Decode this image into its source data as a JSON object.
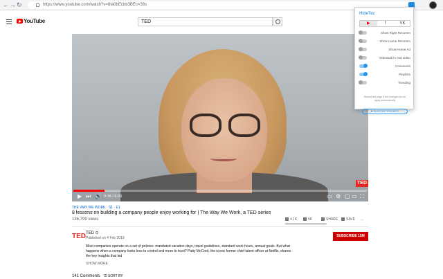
{
  "browser": {
    "url": "https://www.youtube.com/watch?v=8Ia0bEcbb3BEc=38s"
  },
  "header": {
    "logo_text": "YouTube",
    "search_value": "TED"
  },
  "player": {
    "time": "0:38 / 6:03",
    "progress": 0.105,
    "watermark": "TED"
  },
  "video": {
    "series": "THE WAY WE WORK · S1 · E1",
    "title": "8 lessons on building a company people enjoy working for | The Way We Work, a TED series",
    "views": "136,799 views",
    "likes": "4.1K",
    "dislikes": "58",
    "share_label": "SHARE",
    "save_label": "SAVE",
    "more_label": "...",
    "like_ratio": 0.986
  },
  "channel": {
    "logo": "TED",
    "name": "TED ⊙",
    "published": "Published on 4 Feb 2019",
    "subscribe_label": "SUBSCRIBE 15M",
    "description": "Most companies operate on a set of policies: mandated vacation days, travel guidelines, standard work hours, annual goals. But what happens when a company looks less to control and more to trust? Patty McCord, the iconic former chief talent officer at Netflix, shares the key insights that led",
    "show_more": "SHOW MORE"
  },
  "comments": {
    "count": "141 Comments",
    "sort_label": "☰ SORT BY"
  },
  "popup": {
    "title": "HideTec",
    "tabs": [
      {
        "label": "▶",
        "active": true
      },
      {
        "label": "f",
        "active": false
      },
      {
        "label": "VK",
        "active": false
      }
    ],
    "toggles": [
      {
        "label": "Show Right Recomm",
        "on": false
      },
      {
        "label": "Show Home Recomm",
        "on": false
      },
      {
        "label": "Show Home Ad",
        "on": false
      },
      {
        "label": "Videowall in end video",
        "on": false
      },
      {
        "label": "Comments",
        "on": true
      },
      {
        "label": "Playlists",
        "on": true
      },
      {
        "label": "Trending",
        "on": false
      }
    ],
    "note": "Reload the page if the changes do not apply automatically",
    "support_label": "✚  SUPPORT PROJECT",
    "colors": {
      "accent": "#2196f3",
      "title": "#4fa3e0"
    }
  }
}
